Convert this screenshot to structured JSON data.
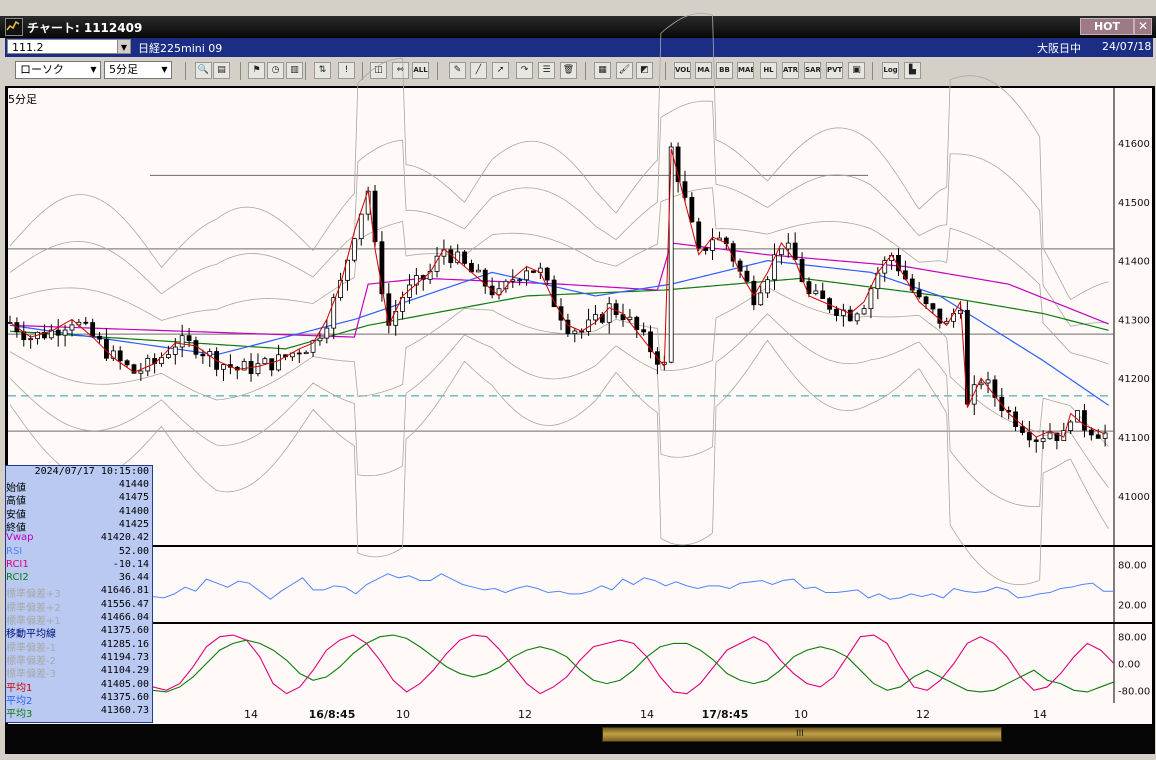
{
  "window": {
    "title": "チャート: 1112409",
    "hot_label": "HOT",
    "close_label": "✕"
  },
  "symbol_bar": {
    "code": "111.2",
    "name": "日経225mini 09",
    "session": "大阪日中",
    "date": "24/07/18"
  },
  "toolbar": {
    "chart_type": "ローソク",
    "period": "5分足",
    "icons": [
      "zoom-icon",
      "table-icon",
      "flag-icon",
      "clock-icon",
      "bar-chart-icon",
      "bidask-icon",
      "alert-icon",
      "fit-icon",
      "range-icon",
      "all-icon",
      "pen-icon",
      "line-icon",
      "cursor-icon",
      "redo-icon",
      "list-icon",
      "trash-icon",
      "grid-icon",
      "brush-icon",
      "color-icon",
      "vol-icon",
      "ma-icon",
      "bb-icon",
      "mae-icon",
      "hl-icon",
      "atr-icon",
      "sar-icon",
      "pvt-icon",
      "frame-icon",
      "log-icon",
      "export-icon"
    ],
    "text_buttons": {
      "all": "ALL",
      "vol": "VOL",
      "ma": "MA",
      "bb": "BB",
      "mae": "MAE",
      "hl": "HL",
      "atr": "ATR",
      "sar": "SAR",
      "pvt": "PVT",
      "log": "Log"
    }
  },
  "chart_label": "5分足",
  "info_panel": {
    "timestamp": "2024/07/17  10:15:00",
    "rows": [
      {
        "label": "始値",
        "value": "41440",
        "color": "#000000"
      },
      {
        "label": "高値",
        "value": "41475",
        "color": "#000000"
      },
      {
        "label": "安値",
        "value": "41400",
        "color": "#000000"
      },
      {
        "label": "終値",
        "value": "41425",
        "color": "#000000"
      },
      {
        "label": "Vwap",
        "value": "41420.42",
        "color": "#c400c4"
      },
      {
        "label": "RSI",
        "value": "52.00",
        "color": "#4f83ff"
      },
      {
        "label": "RCI1",
        "value": "-10.14",
        "color": "#e0007a"
      },
      {
        "label": "RCI2",
        "value": "36.44",
        "color": "#0d7d0d"
      },
      {
        "label": "標準偏差+3",
        "value": "41646.81",
        "color": "#a8a8a8"
      },
      {
        "label": "標準偏差+2",
        "value": "41556.47",
        "color": "#a8a8a8"
      },
      {
        "label": "標準偏差+1",
        "value": "41466.04",
        "color": "#a8a8a8"
      },
      {
        "label": "移動平均線",
        "value": "41375.60",
        "color": "#00107a"
      },
      {
        "label": "標準偏差-1",
        "value": "41285.16",
        "color": "#a8a8a8"
      },
      {
        "label": "標準偏差-2",
        "value": "41194.73",
        "color": "#a8a8a8"
      },
      {
        "label": "標準偏差-3",
        "value": "41104.29",
        "color": "#a8a8a8"
      },
      {
        "label": "平均1",
        "value": "41405.00",
        "color": "#d40000"
      },
      {
        "label": "平均2",
        "value": "41375.60",
        "color": "#2b5fff"
      },
      {
        "label": "平均3",
        "value": "41360.73",
        "color": "#0d7d0d"
      }
    ]
  },
  "colors": {
    "bg": "#fff9f7",
    "candle": "#000000",
    "vwap": "#c400c4",
    "ma1": "#d40000",
    "ma2": "#2b5fff",
    "ma3": "#0d7d0d",
    "band": "#a8a8a8",
    "rsi": "#4f83ff",
    "rci1": "#e0007a",
    "rci2": "#0d7d0d",
    "support_line": "#2a9aa8"
  },
  "chart_data": [
    {
      "type": "candlestick",
      "title": "5分足",
      "y_ticks": [
        41000,
        41100,
        41200,
        41300,
        41400,
        41500,
        41600
      ],
      "ylim": [
        40930,
        41680
      ],
      "x_ticks": [
        "14",
        "16/8:45",
        "10",
        "12",
        "14",
        "17/8:45",
        "10",
        "12",
        "14"
      ],
      "bars": 152,
      "close_approx": [
        [
          0,
          41295
        ],
        [
          6,
          41270
        ],
        [
          12,
          41280
        ],
        [
          18,
          41300
        ],
        [
          24,
          41270
        ],
        [
          30,
          41235
        ],
        [
          36,
          41210
        ],
        [
          42,
          41225
        ],
        [
          48,
          41260
        ],
        [
          54,
          41255
        ],
        [
          60,
          41230
        ],
        [
          66,
          41215
        ],
        [
          72,
          41220
        ],
        [
          78,
          41230
        ],
        [
          84,
          41250
        ],
        [
          88,
          41260
        ],
        [
          92,
          41300
        ],
        [
          96,
          41360
        ],
        [
          100,
          41450
        ],
        [
          104,
          41520
        ],
        [
          106,
          41420
        ],
        [
          110,
          41290
        ],
        [
          114,
          41340
        ],
        [
          118,
          41360
        ],
        [
          122,
          41380
        ],
        [
          126,
          41420
        ],
        [
          130,
          41400
        ],
        [
          134,
          41380
        ],
        [
          138,
          41360
        ],
        [
          142,
          41340
        ],
        [
          146,
          41370
        ],
        [
          150,
          41390
        ],
        [
          154,
          41380
        ],
        [
          158,
          41330
        ],
        [
          162,
          41290
        ],
        [
          166,
          41280
        ],
        [
          170,
          41295
        ],
        [
          174,
          41320
        ],
        [
          178,
          41310
        ],
        [
          182,
          41280
        ],
        [
          186,
          41250
        ],
        [
          190,
          41220
        ],
        [
          192,
          41590
        ],
        [
          196,
          41500
        ],
        [
          200,
          41410
        ],
        [
          204,
          41440
        ],
        [
          208,
          41430
        ],
        [
          212,
          41380
        ],
        [
          216,
          41340
        ],
        [
          220,
          41380
        ],
        [
          224,
          41430
        ],
        [
          228,
          41400
        ],
        [
          232,
          41340
        ],
        [
          236,
          41330
        ],
        [
          240,
          41320
        ],
        [
          244,
          41310
        ],
        [
          248,
          41330
        ],
        [
          252,
          41380
        ],
        [
          256,
          41410
        ],
        [
          260,
          41370
        ],
        [
          264,
          41330
        ],
        [
          268,
          41310
        ],
        [
          272,
          41290
        ],
        [
          276,
          41330
        ],
        [
          278,
          41150
        ],
        [
          282,
          41200
        ],
        [
          286,
          41170
        ],
        [
          290,
          41140
        ],
        [
          294,
          41120
        ],
        [
          298,
          41100
        ],
        [
          302,
          41110
        ],
        [
          306,
          41100
        ],
        [
          308,
          41140
        ],
        [
          312,
          41120
        ],
        [
          316,
          41110
        ],
        [
          320,
          41100
        ]
      ],
      "lines": {
        "vwap_approx": [
          [
            0,
            41290
          ],
          [
            100,
            41270
          ],
          [
            104,
            41360
          ],
          [
            120,
            41370
          ],
          [
            160,
            41360
          ],
          [
            188,
            41350
          ],
          [
            192,
            41430
          ],
          [
            220,
            41410
          ],
          [
            260,
            41390
          ],
          [
            290,
            41360
          ],
          [
            320,
            41290
          ]
        ],
        "ma_mid_approx": [
          [
            0,
            41290
          ],
          [
            60,
            41240
          ],
          [
            100,
            41300
          ],
          [
            140,
            41380
          ],
          [
            170,
            41340
          ],
          [
            192,
            41360
          ],
          [
            220,
            41400
          ],
          [
            250,
            41380
          ],
          [
            270,
            41340
          ],
          [
            300,
            41230
          ],
          [
            320,
            41150
          ]
        ],
        "ma_long_approx": [
          [
            0,
            41280
          ],
          [
            80,
            41250
          ],
          [
            104,
            41290
          ],
          [
            150,
            41340
          ],
          [
            190,
            41350
          ],
          [
            230,
            41370
          ],
          [
            270,
            41340
          ],
          [
            300,
            41310
          ],
          [
            320,
            41280
          ]
        ]
      },
      "horizontal_lines": [
        {
          "value": 41545,
          "color": "#6b6b6b"
        },
        {
          "value": 41420,
          "color": "#6b6b6b"
        },
        {
          "value": 41275,
          "color": "#6b6b6b"
        },
        {
          "value": 41110,
          "color": "#6b6b6b"
        },
        {
          "value": 41170,
          "color": "#2a9aa8",
          "style": "dashed"
        }
      ]
    },
    {
      "type": "line",
      "title": "RSI",
      "y_ticks": [
        80,
        20
      ],
      "ylim": [
        0,
        100
      ],
      "series": [
        {
          "name": "RSI",
          "values": [
            32,
            30,
            36,
            46,
            40,
            58,
            52,
            46,
            55,
            52,
            40,
            28,
            40,
            50,
            60,
            42,
            42,
            48,
            46,
            36,
            50,
            58,
            66,
            60,
            63,
            56,
            56,
            66,
            58,
            50,
            46,
            42,
            44,
            38,
            44,
            48,
            44,
            38,
            40,
            36,
            36,
            40,
            48,
            42,
            58,
            50,
            60,
            56,
            48,
            54,
            48,
            44,
            48,
            48,
            44,
            52,
            54,
            56,
            50,
            56,
            58,
            44,
            46,
            38,
            38,
            40,
            42,
            30,
            36,
            28,
            30,
            36,
            32,
            36,
            30,
            44,
            40,
            38,
            40,
            46,
            42,
            30,
            32,
            36,
            38,
            44,
            46,
            50,
            52,
            40,
            40
          ]
        }
      ]
    },
    {
      "type": "line",
      "title": "RCI",
      "y_ticks": [
        80,
        0,
        -80
      ],
      "ylim": [
        -100,
        100
      ],
      "series": [
        {
          "name": "RCI1",
          "values": [
            -70,
            -80,
            -60,
            -10,
            50,
            80,
            85,
            70,
            20,
            -60,
            -90,
            -70,
            -20,
            40,
            70,
            85,
            60,
            10,
            -50,
            -85,
            -60,
            -20,
            30,
            70,
            85,
            80,
            40,
            -10,
            -60,
            -90,
            -70,
            -40,
            10,
            50,
            60,
            70,
            60,
            20,
            -40,
            -85,
            -90,
            -60,
            -10,
            40,
            60,
            80,
            60,
            10,
            -30,
            -60,
            -70,
            -40,
            20,
            80,
            85,
            60,
            -10,
            -70,
            -80,
            -50,
            0,
            60,
            80,
            60,
            20,
            -40,
            -80,
            -70,
            -30,
            20,
            60,
            40,
            0
          ]
        },
        {
          "name": "RCI2",
          "values": [
            -80,
            -85,
            -70,
            -40,
            0,
            40,
            60,
            70,
            60,
            40,
            10,
            -30,
            -50,
            -40,
            -10,
            30,
            60,
            80,
            85,
            75,
            50,
            20,
            -10,
            -30,
            -40,
            -30,
            -10,
            20,
            40,
            50,
            40,
            20,
            -20,
            -50,
            -60,
            -50,
            -20,
            20,
            50,
            60,
            60,
            40,
            10,
            -30,
            -50,
            -60,
            -50,
            -20,
            20,
            40,
            50,
            40,
            20,
            -20,
            -60,
            -80,
            -70,
            -40,
            -20,
            -40,
            -60,
            -80,
            -85,
            -80,
            -60,
            -40,
            -20,
            -50,
            -60,
            -80,
            -85,
            -70,
            -55
          ]
        }
      ]
    }
  ]
}
